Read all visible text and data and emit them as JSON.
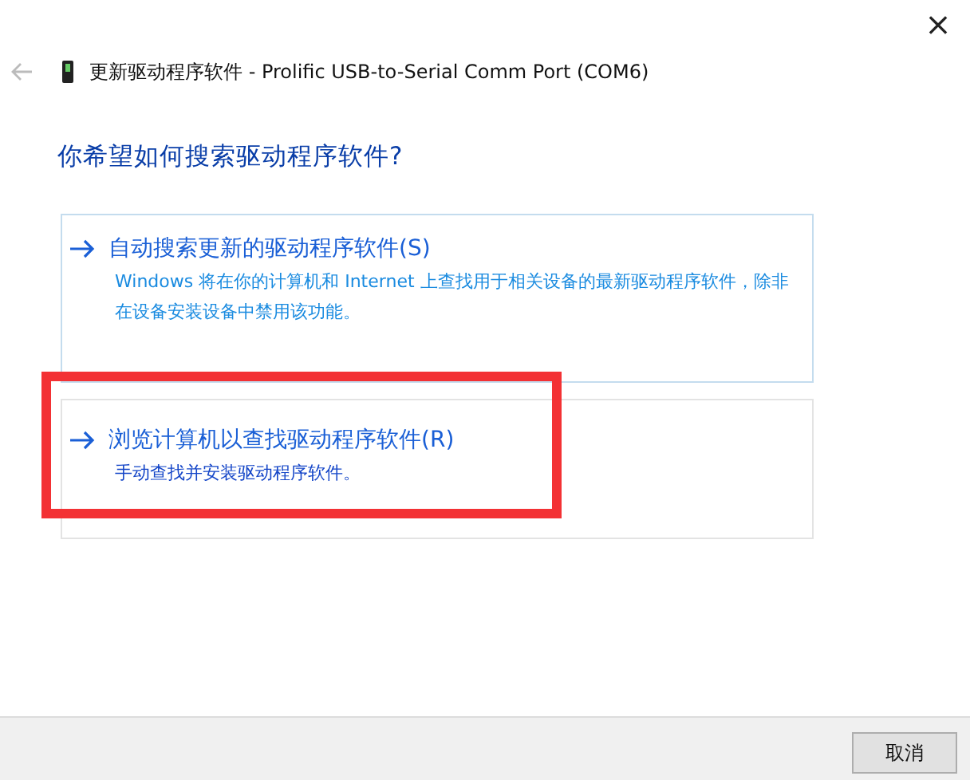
{
  "window": {
    "title": "更新驱动程序软件 - Prolific USB-to-Serial Comm Port (COM6)",
    "close": "×"
  },
  "heading": "你希望如何搜索驱动程序软件?",
  "options": [
    {
      "title": "自动搜索更新的驱动程序软件(S)",
      "description": "Windows 将在你的计算机和 Internet 上查找用于相关设备的最新驱动程序软件，除非在设备安装设备中禁用该功能。",
      "focused": true,
      "highlighted": false
    },
    {
      "title": "浏览计算机以查找驱动程序软件(R)",
      "description": "手动查找并安装驱动程序软件。",
      "focused": false,
      "highlighted": true
    }
  ],
  "buttons": [
    "取消"
  ]
}
